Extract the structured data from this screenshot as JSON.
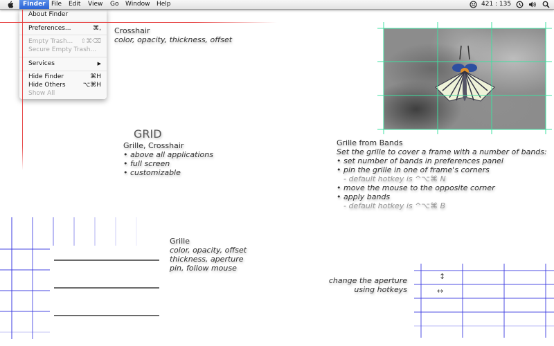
{
  "menubar": {
    "apple_icon": "apple-icon",
    "items": [
      {
        "label": "Finder",
        "active": true
      },
      {
        "label": "File"
      },
      {
        "label": "Edit"
      },
      {
        "label": "View"
      },
      {
        "label": "Go"
      },
      {
        "label": "Window"
      },
      {
        "label": "Help"
      }
    ],
    "status": {
      "grid_icon": "grid-app-icon",
      "coordinates": "421 : 135",
      "time_machine_icon": "time-machine-icon",
      "volume_icon": "volume-icon",
      "spotlight_icon": "spotlight-search-icon"
    }
  },
  "finder_menu": {
    "items": [
      {
        "label": "About Finder",
        "shortcut": "",
        "disabled": false
      },
      {
        "label": "Preferences...",
        "shortcut": "⌘,",
        "disabled": false
      },
      {
        "label": "Empty Trash...",
        "shortcut": "⇧⌘⌫",
        "disabled": true
      },
      {
        "label": "Secure Empty Trash...",
        "shortcut": "",
        "disabled": true
      },
      {
        "label": "Services",
        "shortcut": "▶",
        "disabled": false
      },
      {
        "label": "Hide Finder",
        "shortcut": "⌘H",
        "disabled": false
      },
      {
        "label": "Hide Others",
        "shortcut": "⌥⌘H",
        "disabled": false
      },
      {
        "label": "Show All",
        "shortcut": "",
        "disabled": true
      }
    ]
  },
  "crosshair_section": {
    "title": "Crosshair",
    "subtitle": "color, opacity, thickness, offset",
    "color": "#e63c3c"
  },
  "grid_section": {
    "heading": "GRID",
    "title": "Grille, Crosshair",
    "bullets": [
      "• above all applications",
      "• full screen",
      "• customizable"
    ]
  },
  "bands_section": {
    "title": "Grille from Bands",
    "intro": "Set the grille to cover a frame with a number of bands:",
    "lines": [
      {
        "text": "• set number of bands in preferences panel",
        "note": false
      },
      {
        "text": "• pin the grille in one of frame's corners",
        "note": false
      },
      {
        "text": "- default hotkey is ^⌥⌘ N",
        "note": true
      },
      {
        "text": "• move the mouse to the opposite corner",
        "note": false
      },
      {
        "text": "• apply bands",
        "note": false
      },
      {
        "text": "- default hotkey is ^⌥⌘ B",
        "note": true
      }
    ],
    "grid_color": "#3ee0a0"
  },
  "grille_section": {
    "title": "Grille",
    "lines": [
      "color, opacity, offset",
      "thickness, aperture",
      "pin, follow mouse"
    ],
    "blue_color": "#3a3ae0",
    "gray_color": "#6a6a6a"
  },
  "aperture_section": {
    "lines": [
      "change the aperture",
      "using hotkeys"
    ],
    "vertical_arrow": "↕",
    "horizontal_arrow": "↔",
    "grid_color": "#3a3ae0"
  }
}
